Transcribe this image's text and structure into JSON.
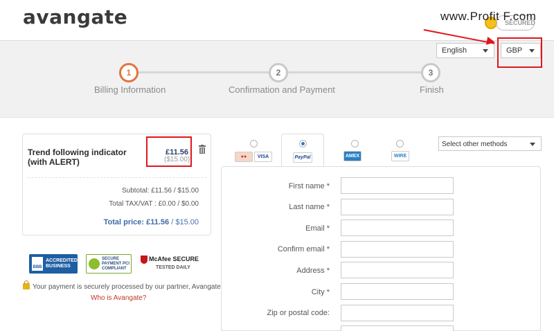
{
  "header": {
    "logo_text": "avangate",
    "watermark": "www.Profit F.com",
    "secured_badge": "SECURED"
  },
  "controls": {
    "language": "English",
    "currency": "GBP"
  },
  "steps": [
    {
      "number": "1",
      "label": "Billing Information",
      "active": true
    },
    {
      "number": "2",
      "label": "Confirmation and Payment",
      "active": false
    },
    {
      "number": "3",
      "label": "Finish",
      "active": false
    }
  ],
  "cart": {
    "product_name": "Trend following indicator (with ALERT)",
    "price": "£11.56",
    "price_usd": "($15.00)",
    "subtotal": "Subtotal: £11.56 / $15.00",
    "tax": "Total TAX/VAT : £0.00 / $0.00",
    "total_label": "Total price:",
    "total_gbp": "£11.56",
    "total_usd": "/ $15.00"
  },
  "trust": {
    "bbb": "ACCREDITED BUSINESS",
    "bbb_mark": "BBB",
    "pci": "SECURE PAYMENT PCI COMPLIANT",
    "mcafee": "McAfee SECURE",
    "mcafee_sub": "TESTED DAILY",
    "note": "Your payment is securely processed by our partner, Avangate.",
    "who_link": "Who is Avangate?"
  },
  "payment": {
    "methods": [
      {
        "name": "MasterCard / VISA",
        "selected": false
      },
      {
        "name": "PayPal",
        "selected": true
      },
      {
        "name": "American Express",
        "selected": false
      },
      {
        "name": "Wire",
        "selected": false
      }
    ],
    "visa_label": "VISA",
    "paypal_label": "PayPal",
    "amex_label": "AMEX",
    "wire_label": "WIRE",
    "other_methods": "Select other methods"
  },
  "form": {
    "fields": [
      {
        "label": "First name *",
        "value": ""
      },
      {
        "label": "Last name *",
        "value": ""
      },
      {
        "label": "Email *",
        "value": ""
      },
      {
        "label": "Confirm email *",
        "value": ""
      },
      {
        "label": "Address *",
        "value": ""
      },
      {
        "label": "City *",
        "value": ""
      },
      {
        "label": "Zip or postal code:",
        "value": ""
      }
    ]
  },
  "colors": {
    "accent_orange": "#e0743d",
    "annotation_red": "#e0161b",
    "link_blue": "#3e6aa6"
  }
}
